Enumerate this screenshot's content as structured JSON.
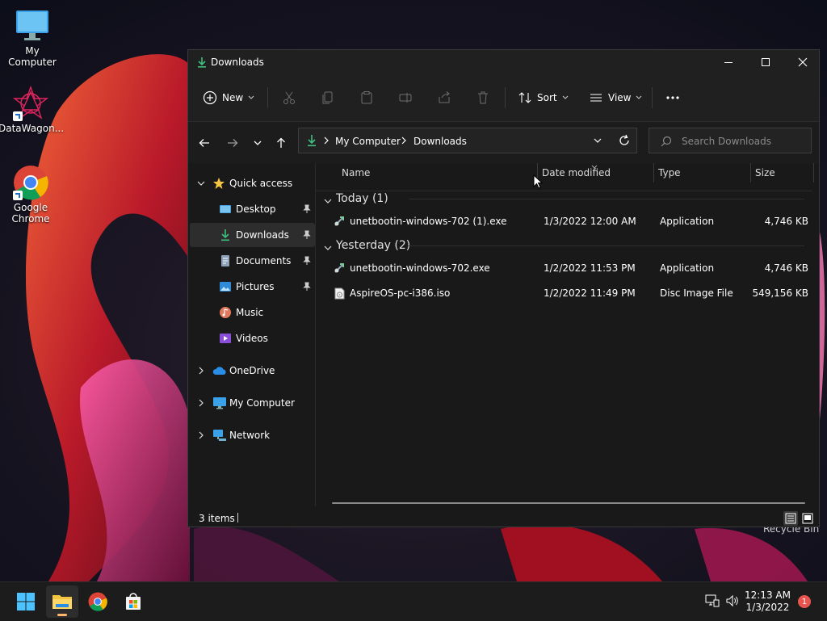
{
  "desktop": {
    "icons": [
      {
        "label": "My Computer"
      },
      {
        "label": "DataWagon..."
      },
      {
        "label": "Google Chrome"
      }
    ],
    "recycle_label": "Recycle Bin"
  },
  "window": {
    "title": "Downloads",
    "toolbar": {
      "new_label": "New",
      "sort_label": "Sort",
      "view_label": "View"
    },
    "address": {
      "crumbs": [
        "My Computer",
        "Downloads"
      ]
    },
    "search": {
      "placeholder": "Search Downloads"
    },
    "nav": {
      "quick_access": "Quick access",
      "items": [
        {
          "label": "Desktop"
        },
        {
          "label": "Downloads"
        },
        {
          "label": "Documents"
        },
        {
          "label": "Pictures"
        },
        {
          "label": "Music"
        },
        {
          "label": "Videos"
        }
      ],
      "onedrive": "OneDrive",
      "my_computer": "My Computer",
      "network": "Network"
    },
    "columns": {
      "name": "Name",
      "date": "Date modified",
      "type": "Type",
      "size": "Size"
    },
    "groups": [
      {
        "label": "Today (1)",
        "files": [
          {
            "name": "unetbootin-windows-702 (1).exe",
            "date": "1/3/2022 12:00 AM",
            "type": "Application",
            "size": "4,746 KB"
          }
        ]
      },
      {
        "label": "Yesterday (2)",
        "files": [
          {
            "name": "unetbootin-windows-702.exe",
            "date": "1/2/2022 11:53 PM",
            "type": "Application",
            "size": "4,746 KB"
          },
          {
            "name": "AspireOS-pc-i386.iso",
            "date": "1/2/2022 11:49 PM",
            "type": "Disc Image File",
            "size": "549,156 KB"
          }
        ]
      }
    ],
    "status": {
      "item_count": "3 items"
    }
  },
  "taskbar": {
    "time": "12:13 AM",
    "date": "1/3/2022",
    "notification_count": "1"
  },
  "colors": {
    "accent": "#4cc2ff",
    "download_green": "#3fbf7f",
    "folder_yellow": "#f5c542"
  }
}
